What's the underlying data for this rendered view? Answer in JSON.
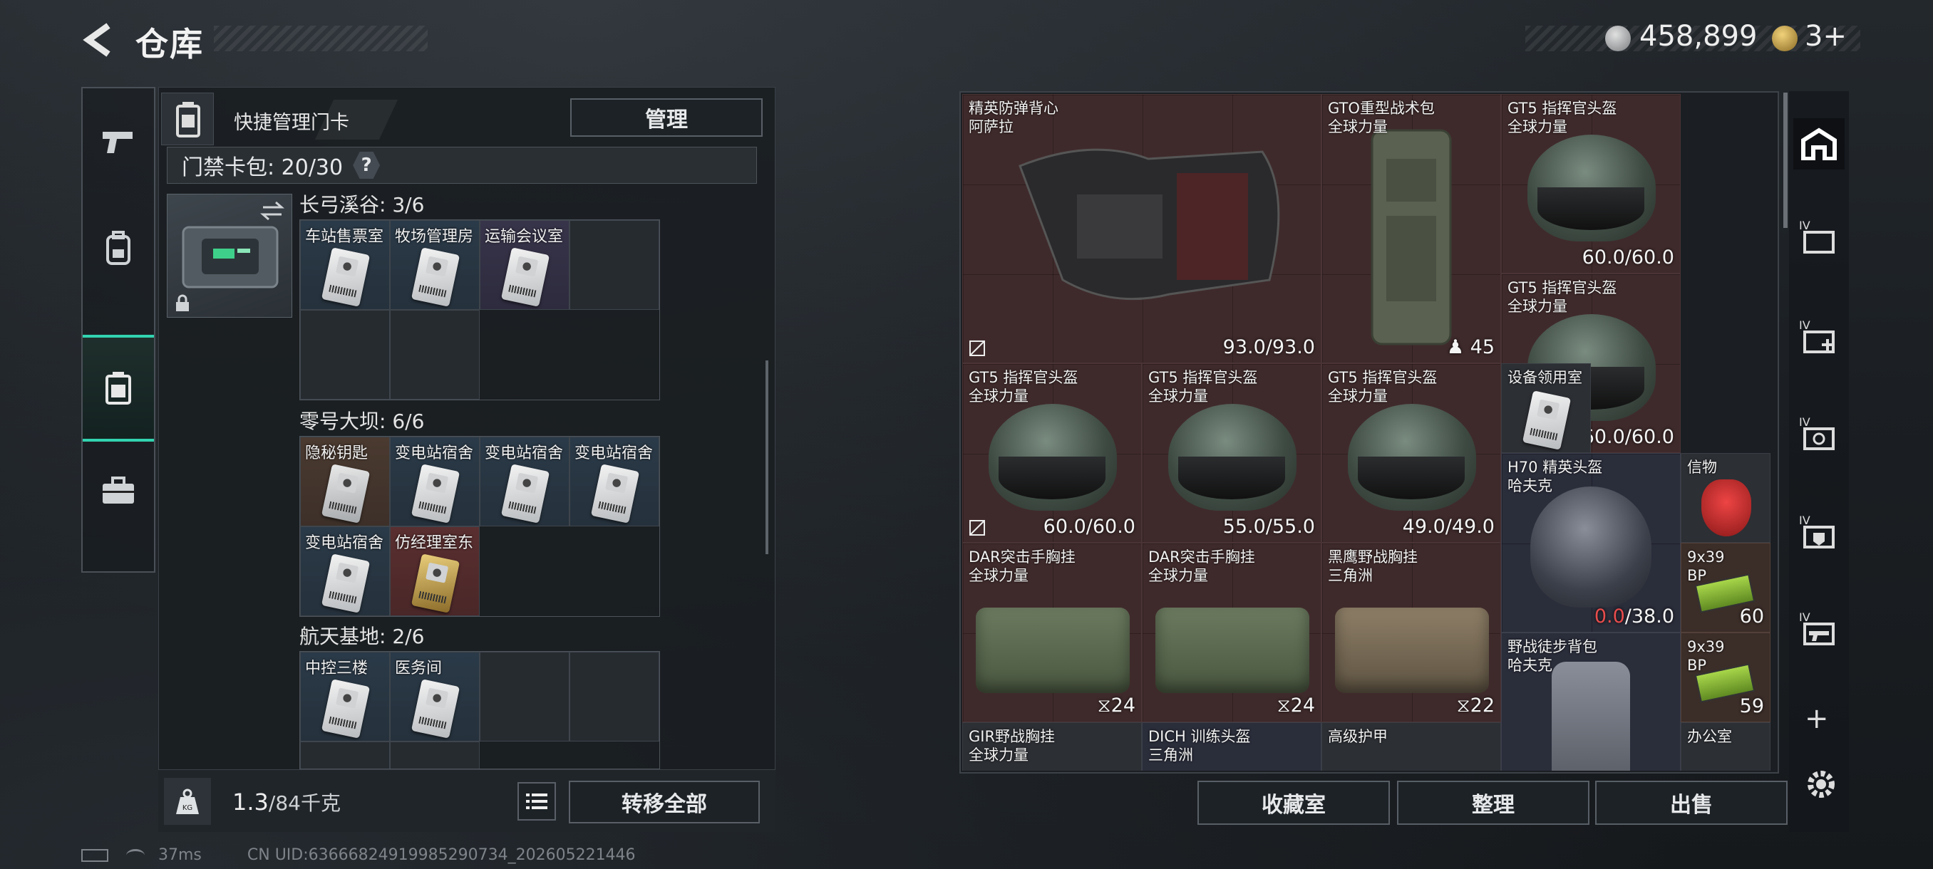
{
  "header": {
    "title": "仓库",
    "currency": "458,899",
    "tokens": "3+"
  },
  "left_panel": {
    "quick_manage_label": "快捷管理门卡",
    "manage_button": "管理",
    "card_bag_label": "门禁卡包: 20/30",
    "help": "?",
    "sections": [
      {
        "title": "长弓溪谷: 3/6",
        "cards": [
          "车站售票室",
          "牧场管理房",
          "运输会议室"
        ]
      },
      {
        "title": "零号大坝: 6/6",
        "cards": [
          "隐秘钥匙",
          "变电站宿舍",
          "变电站宿舍",
          "变电站宿舍",
          "变电站宿舍",
          "仿经理室东"
        ]
      },
      {
        "title": "航天基地: 2/6",
        "cards": [
          "中控三楼",
          "医务间"
        ]
      }
    ],
    "weight_value": "1.3",
    "weight_capacity": "/84千克",
    "transfer_all_button": "转移全部"
  },
  "inventory": {
    "items": [
      {
        "name": "精英防弹背心",
        "sub": "阿萨拉",
        "value": "93.0/93.0"
      },
      {
        "name": "GTO重型战术包",
        "sub": "全球力量",
        "value": "45"
      },
      {
        "name": "GT5 指挥官头盔",
        "sub": "全球力量",
        "value": "60.0/60.0"
      },
      {
        "name": "GT5 指挥官头盔",
        "sub": "全球力量",
        "value": "60.0/60.0"
      },
      {
        "name": "GT5 指挥官头盔",
        "sub": "全球力量",
        "value": "60.0/60.0"
      },
      {
        "name": "GT5 指挥官头盔",
        "sub": "全球力量",
        "value": "55.0/55.0"
      },
      {
        "name": "GT5 指挥官头盔",
        "sub": "全球力量",
        "value": "49.0/49.0"
      },
      {
        "name": "设备领用室",
        "sub": "",
        "value": ""
      },
      {
        "name": "H70 精英头盔",
        "sub": "哈夫克",
        "value_zero": "0.0",
        "value_rest": "/38.0"
      },
      {
        "name": "信物",
        "sub": "",
        "value": ""
      },
      {
        "name": "DAR突击手胸挂",
        "sub": "全球力量",
        "value": "24"
      },
      {
        "name": "DAR突击手胸挂",
        "sub": "全球力量",
        "value": "24"
      },
      {
        "name": "黑鹰野战胸挂",
        "sub": "三角洲",
        "value": "22"
      },
      {
        "name": "9x39",
        "sub": "BP",
        "value": "60"
      },
      {
        "name": "野战徒步背包",
        "sub": "哈夫克",
        "value": ""
      },
      {
        "name": "9x39",
        "sub": "BP",
        "value": "59"
      },
      {
        "name": "GIR野战胸挂",
        "sub": "全球力量",
        "value": ""
      },
      {
        "name": "DICH 训练头盔",
        "sub": "三角洲",
        "value": ""
      },
      {
        "name": "高级护甲",
        "sub": "",
        "value": ""
      },
      {
        "name": "办公室",
        "sub": "",
        "value": ""
      }
    ]
  },
  "bottom_buttons": {
    "collection": "收藏室",
    "sort": "整理",
    "sell": "出售"
  },
  "status_bar": {
    "ping": "37ms",
    "uid": "CN UID:6366682491998529073​4_202605221446"
  },
  "colors": {
    "accent": "#32d3b0",
    "item_red": "#3f2a2b",
    "warn": "#e84c4c"
  }
}
